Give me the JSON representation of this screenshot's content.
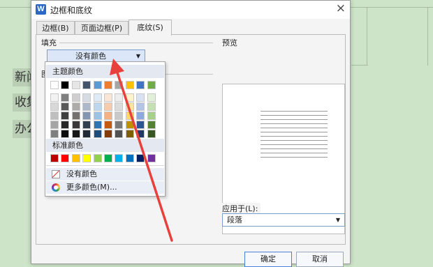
{
  "document": {
    "lines": [
      "新闻",
      "收集",
      "办公"
    ]
  },
  "dialog": {
    "app_icon_letter": "W",
    "title": "边框和底纹",
    "close_glyph": "×",
    "tabs": [
      {
        "label": "边框(B)",
        "active": false
      },
      {
        "label": "页面边框(P)",
        "active": false
      },
      {
        "label": "底纹(S)",
        "active": true
      }
    ],
    "fill": {
      "label": "填充",
      "selected": "没有颜色",
      "arrow": "▼"
    },
    "pattern_label_partial": "图",
    "preview": {
      "label": "预览"
    },
    "apply_to": {
      "label": "应用于(L):",
      "value": "段落",
      "arrow": "▼"
    },
    "buttons": {
      "ok": "确定",
      "cancel": "取消"
    }
  },
  "color_popup": {
    "theme_header": "主题颜色",
    "standard_header": "标准颜色",
    "no_color": "没有颜色",
    "more_colors": "更多颜色(M)...",
    "theme_top": [
      "#ffffff",
      "#000000",
      "#e7e6e6",
      "#44546a",
      "#5b9bd5",
      "#ed7d31",
      "#a5a5a5",
      "#ffc000",
      "#4472c4",
      "#70ad47"
    ],
    "theme_shades": [
      [
        "#f2f2f2",
        "#7f7f7f",
        "#d0cece",
        "#d6dce4",
        "#deebf6",
        "#fbe5d5",
        "#ededed",
        "#fff2cc",
        "#d9e2f3",
        "#e2efd9"
      ],
      [
        "#d8d8d8",
        "#595959",
        "#aeabab",
        "#adb9ca",
        "#bdd7ee",
        "#f7cbac",
        "#dbdbdb",
        "#fee599",
        "#b4c6e7",
        "#c5e0b3"
      ],
      [
        "#bfbfbf",
        "#3f3f3f",
        "#757070",
        "#8496b0",
        "#9cc3e5",
        "#f4b183",
        "#c9c9c9",
        "#ffd965",
        "#8eaadb",
        "#a8d08d"
      ],
      [
        "#a5a5a5",
        "#262626",
        "#3a3838",
        "#323f4f",
        "#2e75b5",
        "#c55a11",
        "#7b7b7b",
        "#bf9000",
        "#2f5496",
        "#538135"
      ],
      [
        "#7f7f7f",
        "#0c0c0c",
        "#171616",
        "#222a35",
        "#1e4e79",
        "#833c0b",
        "#525252",
        "#7f6000",
        "#1f3864",
        "#375623"
      ]
    ],
    "standard": [
      "#c00000",
      "#ff0000",
      "#ffc000",
      "#ffff00",
      "#92d050",
      "#00b050",
      "#00b0f0",
      "#0070c0",
      "#002060",
      "#7030a0"
    ]
  },
  "annotation": {
    "arrow_color": "#e8413c"
  }
}
